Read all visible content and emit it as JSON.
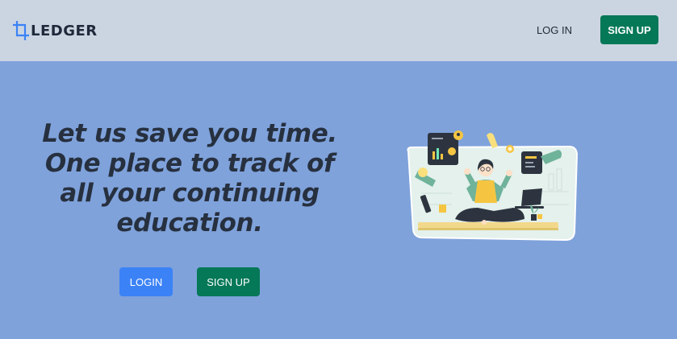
{
  "brand": {
    "name": "LEDGER",
    "icon": "crop-icon"
  },
  "nav": {
    "login_label": "LOG IN",
    "signup_label": "SIGN UP"
  },
  "hero": {
    "headline_lines": [
      "Let us save you time.",
      "One place to track of",
      "all your continuing",
      "education."
    ],
    "login_label": "LOGIN",
    "signup_label": "SIGN UP",
    "illustration": "multitasking-meditating-woman-illustration"
  },
  "colors": {
    "navbar_bg": "#cbd5e1",
    "page_bg": "#7fa2db",
    "primary_green": "#047857",
    "primary_blue": "#3b82f6",
    "brand_accent": "#3b82f6",
    "text_dark": "#27303f"
  }
}
